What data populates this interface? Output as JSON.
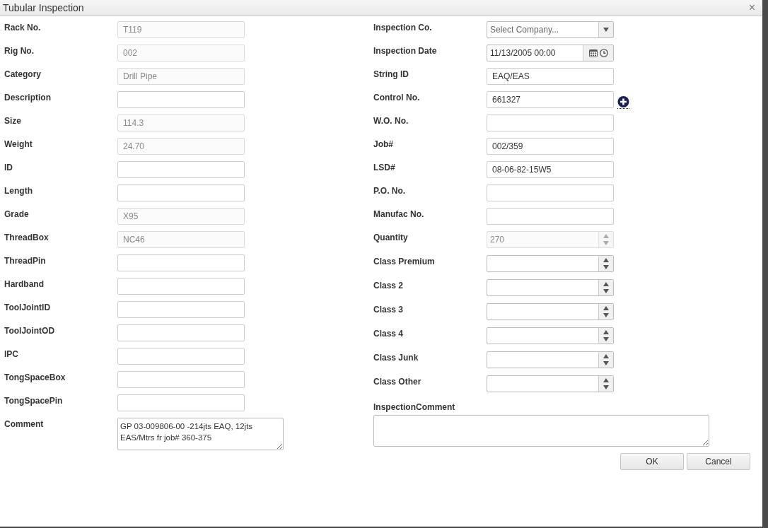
{
  "window": {
    "title": "Tubular Inspection",
    "close": "×"
  },
  "left_fields": [
    {
      "label": "Rack No.",
      "kind": "text",
      "value": "T119",
      "disabled": true
    },
    {
      "label": "Rig No.",
      "kind": "text",
      "value": "002",
      "disabled": true
    },
    {
      "label": "Category",
      "kind": "text",
      "value": "Drill Pipe",
      "disabled": true
    },
    {
      "label": "Description",
      "kind": "text",
      "disabled": false
    },
    {
      "label": "Size",
      "kind": "text",
      "value": "114.3",
      "disabled": true
    },
    {
      "label": "Weight",
      "kind": "text",
      "value": "24.70",
      "disabled": true
    },
    {
      "label": "ID",
      "kind": "text",
      "disabled": false
    },
    {
      "label": "Length",
      "kind": "text",
      "disabled": false
    },
    {
      "label": "Grade",
      "kind": "text",
      "value": "X95",
      "disabled": true
    },
    {
      "label": "ThreadBox",
      "kind": "text",
      "value": "NC46",
      "disabled": true
    },
    {
      "label": "ThreadPin",
      "kind": "text",
      "disabled": false
    },
    {
      "label": "Hardband",
      "kind": "text",
      "disabled": false
    },
    {
      "label": "ToolJointID",
      "kind": "text",
      "disabled": false
    },
    {
      "label": "ToolJointOD",
      "kind": "text",
      "disabled": false
    },
    {
      "label": "IPC",
      "kind": "text",
      "disabled": false
    },
    {
      "label": "TongSpaceBox",
      "kind": "text",
      "disabled": false
    },
    {
      "label": "TongSpacePin",
      "kind": "text",
      "disabled": false
    },
    {
      "label": "Comment",
      "kind": "textarea",
      "value": "GP 03-009806-00 -214jts EAQ, 12jts EAS/Mtrs fr job# 360-375",
      "disabled": false
    }
  ],
  "right_fields": [
    {
      "label": "Inspection Co.",
      "kind": "select",
      "placeholder": "Select Company...",
      "disabled": false
    },
    {
      "label": "Inspection Date",
      "kind": "datetime",
      "value": "11/13/2005 00:00",
      "disabled": false
    },
    {
      "label": "String ID",
      "kind": "text",
      "value": "EAQ/EAS",
      "disabled": false
    },
    {
      "label": "Control No.",
      "kind": "text-add",
      "value": "661327",
      "disabled": false
    },
    {
      "label": "W.O. No.",
      "kind": "text",
      "disabled": false
    },
    {
      "label": "Job#",
      "kind": "text",
      "value": "002/359",
      "disabled": false
    },
    {
      "label": "LSD#",
      "kind": "text",
      "value": "08-06-82-15W5",
      "disabled": false
    },
    {
      "label": "P.O. No.",
      "kind": "text",
      "disabled": false
    },
    {
      "label": "Manufac No.",
      "kind": "text",
      "disabled": false
    },
    {
      "label": "Quantity",
      "kind": "spinner",
      "value": "270",
      "disabled": true
    },
    {
      "label": "Class Premium",
      "kind": "spinner",
      "disabled": false
    },
    {
      "label": "Class 2",
      "kind": "spinner",
      "disabled": false
    },
    {
      "label": "Class 3",
      "kind": "spinner",
      "disabled": false
    },
    {
      "label": "Class 4",
      "kind": "spinner",
      "disabled": false
    },
    {
      "label": "Class Junk",
      "kind": "spinner",
      "disabled": false
    },
    {
      "label": "Class Other",
      "kind": "spinner",
      "disabled": false
    }
  ],
  "inspection_comment": {
    "label": "InspectionComment"
  },
  "buttons": [
    {
      "label": "OK"
    },
    {
      "label": "Cancel"
    }
  ]
}
